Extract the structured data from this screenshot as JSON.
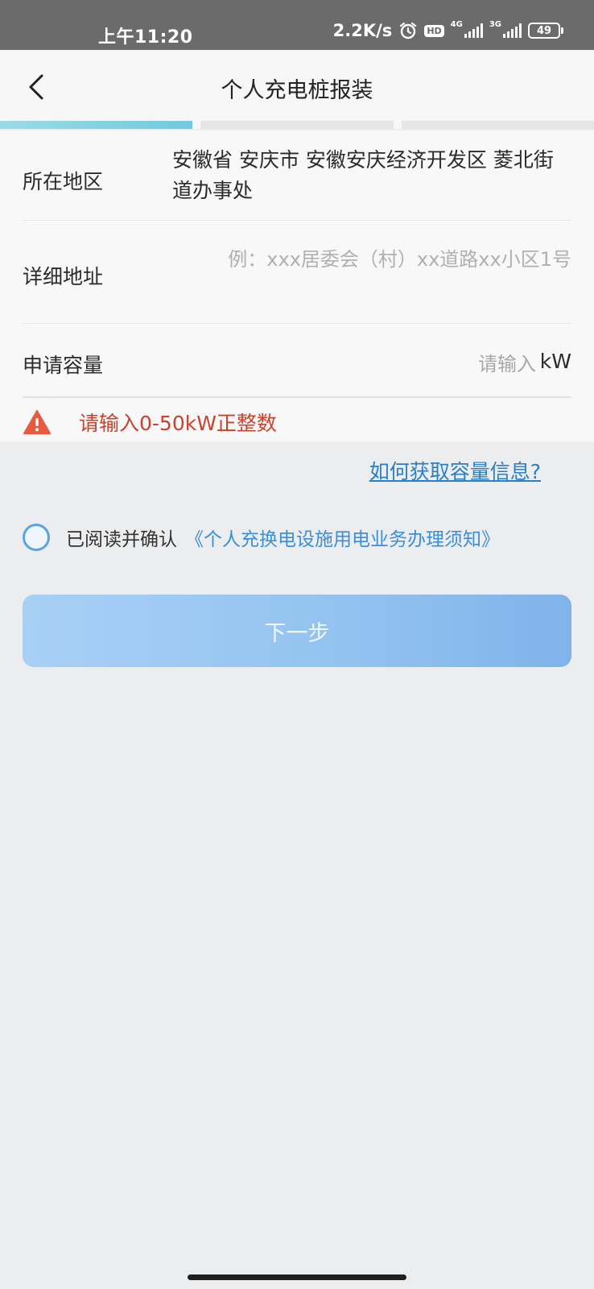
{
  "status_bar": {
    "time": "上午11:20",
    "net_speed": "2.2K/s",
    "hd_label": "HD",
    "sim1_net": "4G",
    "sim2_net": "3G",
    "battery": "49"
  },
  "header": {
    "title": "个人充电桩报装"
  },
  "progress": {
    "steps": 3,
    "current": 1
  },
  "form": {
    "region_label": "所在地区",
    "region_value": "安徽省 安庆市 安徽安庆经济开发区 菱北街道办事处",
    "address_label": "详细地址",
    "address_value": "",
    "address_placeholder": "例：xxx居委会（村）xx道路xx小区1号",
    "capacity_label": "申请容量",
    "capacity_value": "",
    "capacity_placeholder": "请输入",
    "capacity_unit": "kW",
    "warning_text": "请输入0-50kW正整数"
  },
  "help_link": "如何获取容量信息?",
  "agreement": {
    "prefix": "已阅读并确认",
    "link": "《个人充换电设施用电业务办理须知》"
  },
  "next_button": "下一步",
  "colors": {
    "accent": "#5aa2e6",
    "warning": "#c9432c",
    "link": "#2b7fc6",
    "progress": "#6ecbdd"
  }
}
